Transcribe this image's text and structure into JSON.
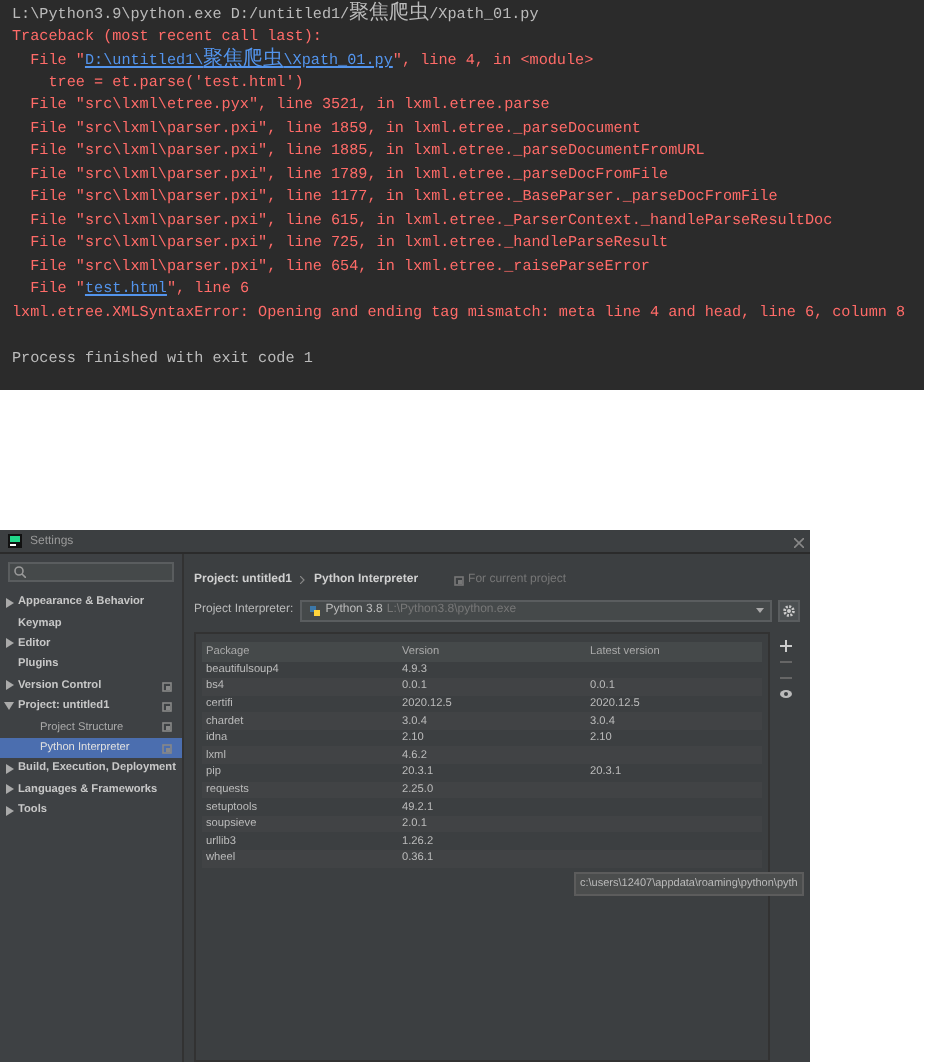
{
  "console": {
    "lines": [
      {
        "kind": "plain",
        "parts": [
          {
            "text": "L:\\Python3.9\\python.exe D:/untitled1/聚焦爬虫/Xpath_01.py"
          }
        ]
      },
      {
        "kind": "error",
        "parts": [
          {
            "text": "Traceback (most recent call last):"
          }
        ]
      },
      {
        "kind": "error",
        "parts": [
          {
            "text": "  File \""
          },
          {
            "text": "D:\\untitled1\\聚焦爬虫\\Xpath_01.py",
            "link": true
          },
          {
            "text": "\", line 4, in <module>"
          }
        ]
      },
      {
        "kind": "error",
        "parts": [
          {
            "text": "    tree = et.parse('test.html')"
          }
        ]
      },
      {
        "kind": "error",
        "parts": [
          {
            "text": "  File \"src\\lxml\\etree.pyx\", line 3521, in lxml.etree.parse"
          }
        ]
      },
      {
        "kind": "error",
        "parts": [
          {
            "text": "  File \"src\\lxml\\parser.pxi\", line 1859, in lxml.etree._parseDocument"
          }
        ]
      },
      {
        "kind": "error",
        "parts": [
          {
            "text": "  File \"src\\lxml\\parser.pxi\", line 1885, in lxml.etree._parseDocumentFromURL"
          }
        ]
      },
      {
        "kind": "error",
        "parts": [
          {
            "text": "  File \"src\\lxml\\parser.pxi\", line 1789, in lxml.etree._parseDocFromFile"
          }
        ]
      },
      {
        "kind": "error",
        "parts": [
          {
            "text": "  File \"src\\lxml\\parser.pxi\", line 1177, in lxml.etree._BaseParser._parseDocFromFile"
          }
        ]
      },
      {
        "kind": "error",
        "parts": [
          {
            "text": "  File \"src\\lxml\\parser.pxi\", line 615, in lxml.etree._ParserContext._handleParseResultDoc"
          }
        ]
      },
      {
        "kind": "error",
        "parts": [
          {
            "text": "  File \"src\\lxml\\parser.pxi\", line 725, in lxml.etree._handleParseResult"
          }
        ]
      },
      {
        "kind": "error",
        "parts": [
          {
            "text": "  File \"src\\lxml\\parser.pxi\", line 654, in lxml.etree._raiseParseError"
          }
        ]
      },
      {
        "kind": "error",
        "parts": [
          {
            "text": "  File \""
          },
          {
            "text": "test.html",
            "link": true
          },
          {
            "text": "\", line 6"
          }
        ]
      },
      {
        "kind": "error",
        "parts": [
          {
            "text": "lxml.etree.XMLSyntaxError: Opening and ending tag mismatch: meta line 4 and head, line 6, column 8"
          }
        ]
      },
      {
        "kind": "blank"
      },
      {
        "kind": "plain",
        "parts": [
          {
            "text": "Process finished with exit code 1"
          }
        ]
      }
    ]
  },
  "settings": {
    "title": "Settings",
    "sidebar": {
      "items": [
        {
          "label": "Appearance & Behavior",
          "expanded": false,
          "selected": false,
          "scope_icon": false
        },
        {
          "label": "Keymap",
          "selected": false,
          "scope_icon": false
        },
        {
          "label": "Editor",
          "expanded": false,
          "selected": false,
          "scope_icon": false
        },
        {
          "label": "Plugins",
          "selected": false,
          "scope_icon": false
        },
        {
          "label": "Version Control",
          "expanded": false,
          "selected": false,
          "scope_icon": true
        },
        {
          "label": "Project: untitled1",
          "expanded": true,
          "selected": false,
          "scope_icon": true,
          "children": [
            {
              "label": "Project Structure",
              "selected": false,
              "scope_icon": true
            },
            {
              "label": "Python Interpreter",
              "selected": true,
              "scope_icon": true
            }
          ]
        },
        {
          "label": "Build, Execution, Deployment",
          "expanded": false,
          "selected": false,
          "scope_icon": false
        },
        {
          "label": "Languages & Frameworks",
          "expanded": false,
          "selected": false,
          "scope_icon": false
        },
        {
          "label": "Tools",
          "expanded": false,
          "selected": false,
          "scope_icon": false
        }
      ]
    },
    "breadcrumb": [
      "Project: untitled1",
      "Python Interpreter"
    ],
    "scope_note": "For current project",
    "interpreter": {
      "label": "Project Interpreter:",
      "name": "Python 3.8",
      "path": "L:\\Python3.8\\python.exe"
    },
    "table": {
      "columns": [
        "Package",
        "Version",
        "Latest version"
      ],
      "rows": [
        {
          "package": "beautifulsoup4",
          "version": "4.9.3"
        },
        {
          "package": "bs4",
          "version": "0.0.1",
          "latest": "0.0.1"
        },
        {
          "package": "certifi",
          "version": "2020.12.5",
          "latest": "2020.12.5"
        },
        {
          "package": "chardet",
          "version": "3.0.4",
          "latest": "3.0.4"
        },
        {
          "package": "idna",
          "version": "2.10",
          "latest": "2.10"
        },
        {
          "package": "lxml",
          "version": "4.6.2"
        },
        {
          "package": "pip",
          "version": "20.3.1",
          "latest": "20.3.1"
        },
        {
          "package": "requests",
          "version": "2.25.0"
        },
        {
          "package": "setuptools",
          "version": "49.2.1"
        },
        {
          "package": "soupsieve",
          "version": "2.0.1"
        },
        {
          "package": "urllib3",
          "version": "1.26.2"
        },
        {
          "package": "wheel",
          "version": "0.36.1"
        }
      ]
    },
    "tooltip": "c:\\users\\12407\\appdata\\roaming\\python\\pyth"
  }
}
